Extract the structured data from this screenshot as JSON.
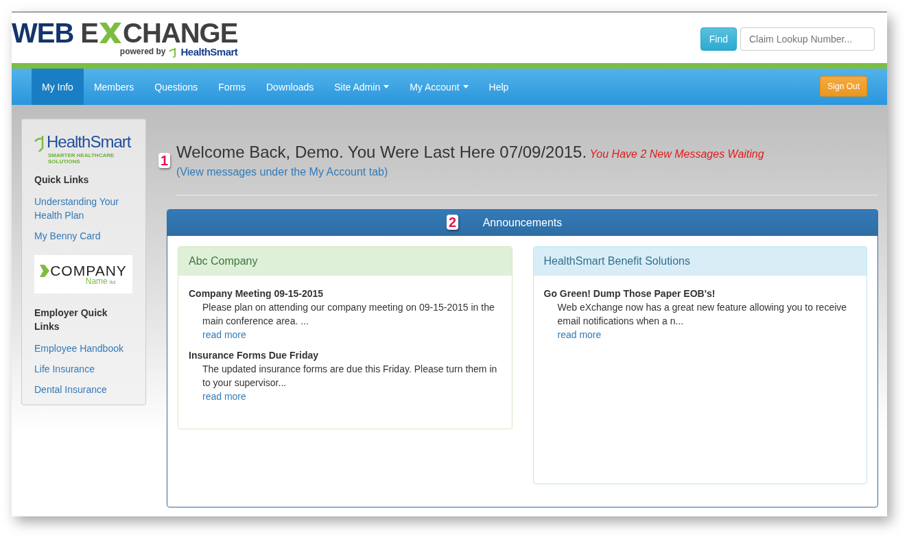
{
  "header": {
    "logo": {
      "word_1": "WEB",
      "word_2_start": "E",
      "word_2_end": "CHANGE",
      "tagline": "powered by",
      "brand": "HealthSmart"
    },
    "find_button": "Find",
    "search": {
      "placeholder": "Claim Lookup Number..."
    }
  },
  "nav": {
    "items": [
      {
        "label": "My Info",
        "selected": true,
        "dropdown": false
      },
      {
        "label": "Members",
        "selected": false,
        "dropdown": false
      },
      {
        "label": "Questions",
        "selected": false,
        "dropdown": false
      },
      {
        "label": "Forms",
        "selected": false,
        "dropdown": false
      },
      {
        "label": "Downloads",
        "selected": false,
        "dropdown": false
      },
      {
        "label": "Site Admin",
        "selected": false,
        "dropdown": true
      },
      {
        "label": "My Account",
        "selected": false,
        "dropdown": true
      },
      {
        "label": "Help",
        "selected": false,
        "dropdown": false
      }
    ],
    "sign_out": "Sign Out"
  },
  "sidebar": {
    "brand_logo": {
      "brand": "HealthSmart",
      "tagline": "SMARTER HEALTHCARE SOLUTIONS"
    },
    "quick_links": {
      "heading": "Quick Links",
      "links": [
        "Understanding Your Health Plan",
        "My Benny Card"
      ]
    },
    "company_logo": {
      "name": "COMPANY",
      "subname": "Name",
      "suffix": "ltd"
    },
    "employer_links": {
      "heading": "Employer Quick Links",
      "links": [
        "Employee Handbook",
        "Life Insurance",
        "Dental Insurance"
      ]
    }
  },
  "welcome": {
    "text": "Welcome Back, Demo. You Were Last Here 07/09/2015.",
    "alert": "You Have 2 New Messages Waiting",
    "link": "(View messages under the My Account tab)"
  },
  "callouts": [
    "1",
    "2"
  ],
  "announcements": {
    "title": "Announcements",
    "cards": [
      {
        "kind": "success",
        "title": "Abc Company",
        "items": [
          {
            "title": "Company Meeting 09-15-2015",
            "body": "Please plan on attending our company meeting on 09-15-2015 in the main conference area. ...",
            "more": "read more"
          },
          {
            "title": "Insurance Forms Due Friday",
            "body": "The updated insurance forms are due this Friday.  Please turn them in to your supervisor...",
            "more": "read more"
          }
        ]
      },
      {
        "kind": "info",
        "title": "HealthSmart Benefit Solutions",
        "items": [
          {
            "title": "Go Green! Dump Those Paper EOB's!",
            "body": "Web eXchange now has a great new feature allowing you to receive email notifications when a n...",
            "more": "read more"
          }
        ]
      }
    ]
  }
}
